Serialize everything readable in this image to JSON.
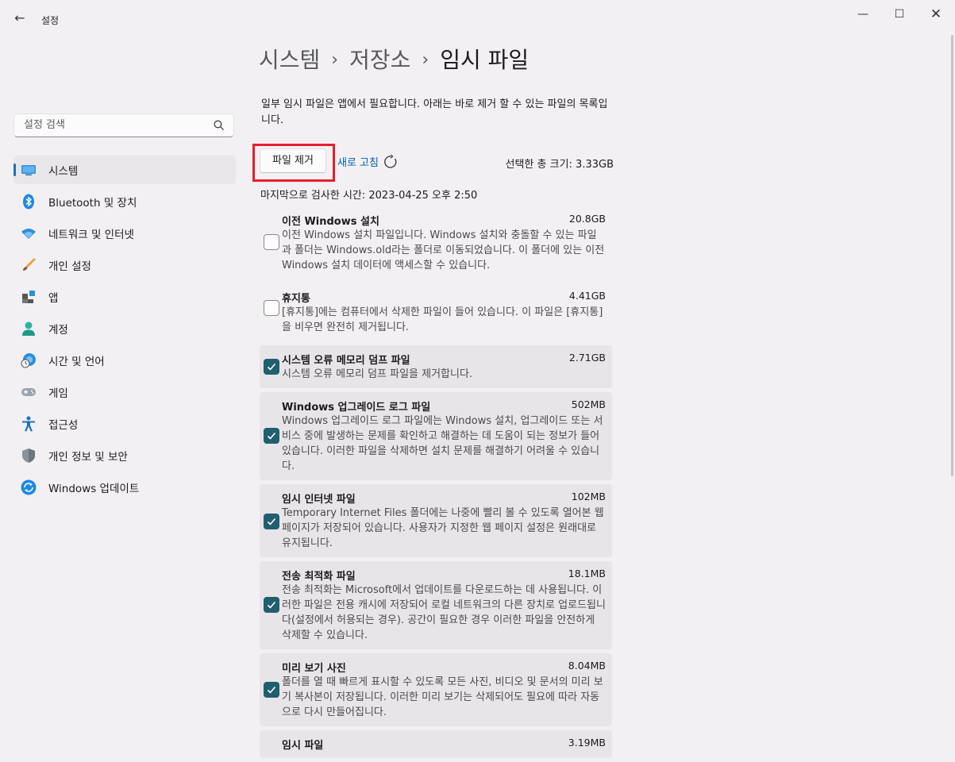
{
  "window": {
    "title": "설정",
    "back_icon": "←",
    "min_icon": "—",
    "max_icon": "☐",
    "close_icon": "✕"
  },
  "search": {
    "placeholder": "설정 검색",
    "value": ""
  },
  "sidebar": {
    "items": [
      {
        "label": "시스템",
        "icon": "system-icon",
        "active": true
      },
      {
        "label": "Bluetooth 및 장치",
        "icon": "bluetooth-icon"
      },
      {
        "label": "네트워크 및 인터넷",
        "icon": "wifi-icon"
      },
      {
        "label": "개인 설정",
        "icon": "brush-icon"
      },
      {
        "label": "앱",
        "icon": "apps-icon"
      },
      {
        "label": "계정",
        "icon": "person-icon"
      },
      {
        "label": "시간 및 언어",
        "icon": "globe-clock-icon"
      },
      {
        "label": "게임",
        "icon": "gamepad-icon"
      },
      {
        "label": "접근성",
        "icon": "accessibility-icon"
      },
      {
        "label": "개인 정보 및 보안",
        "icon": "shield-icon"
      },
      {
        "label": "Windows 업데이트",
        "icon": "update-icon"
      }
    ]
  },
  "breadcrumb": {
    "level1": "시스템",
    "level2": "저장소",
    "current": "임시 파일",
    "sep": "›"
  },
  "intro_text": "일부 임시 파일은 앱에서 필요합니다. 아래는 바로 제거 할 수 있는 파일의 목록입니다.",
  "actions": {
    "remove_label": "파일 제거",
    "refresh_label": "새로 고침",
    "total_label": "선택한 총 크기: 3.33GB",
    "highlight_color": "#e5202e"
  },
  "last_scan": "마지막으로 검사한 시간: 2023-04-25 오후 2:50",
  "files": [
    {
      "title": "이전 Windows 설치",
      "size": "20.8GB",
      "checked": false,
      "desc": "이전 Windows 설치 파일입니다. Windows 설치와 충돌할 수 있는 파일과 폴더는 Windows.old라는 폴더로 이동되었습니다. 이 폴더에 있는 이전 Windows 설치 데이터에 액세스할 수 있습니다."
    },
    {
      "title": "휴지통",
      "size": "4.41GB",
      "checked": false,
      "desc": "[휴지통]에는 컴퓨터에서 삭제한 파일이 들어 있습니다. 이 파일은 [휴지통]을 비우면 완전히 제거됩니다."
    },
    {
      "title": "시스템 오류 메모리 덤프 파일",
      "size": "2.71GB",
      "checked": true,
      "desc": "시스템 오류 메모리 덤프 파일을 제거합니다."
    },
    {
      "title": "Windows 업그레이드 로그 파일",
      "size": "502MB",
      "checked": true,
      "desc": "Windows 업그레이드 로그 파일에는 Windows 설치, 업그레이드 또는 서비스 중에 발생하는 문제를 확인하고 해결하는 데 도움이 되는 정보가 들어 있습니다. 이러한 파일을 삭제하면 설치 문제를 해결하기 어려울 수 있습니다."
    },
    {
      "title": "임시 인터넷 파일",
      "size": "102MB",
      "checked": true,
      "desc": "Temporary Internet Files 폴더에는 나중에 빨리 볼 수 있도록 열어본 웹 페이지가 저장되어 있습니다. 사용자가 지정한 웹 페이지 설정은 원래대로 유지됩니다."
    },
    {
      "title": "전송 최적화 파일",
      "size": "18.1MB",
      "checked": true,
      "desc": "전송 최적화는 Microsoft에서 업데이트를 다운로드하는 데 사용됩니다. 이러한 파일은 전용 캐시에 저장되어 로컬 네트워크의 다른 장치로 업로드됩니다(설정에서 허용되는 경우). 공간이 필요한 경우 이러한 파일을 안전하게 삭제할 수 있습니다."
    },
    {
      "title": "미리 보기 사진",
      "size": "8.04MB",
      "checked": true,
      "desc": "폴더를 열 때 빠르게 표시할 수 있도록 모든 사진, 비디오 및 문서의 미리 보기 복사본이 저장됩니다. 이러한 미리 보기는 삭제되어도 필요에 따라 자동으로 다시 만들어집니다."
    },
    {
      "title": "임시 파일",
      "size": "3.19MB",
      "checked": true,
      "desc": ""
    }
  ]
}
